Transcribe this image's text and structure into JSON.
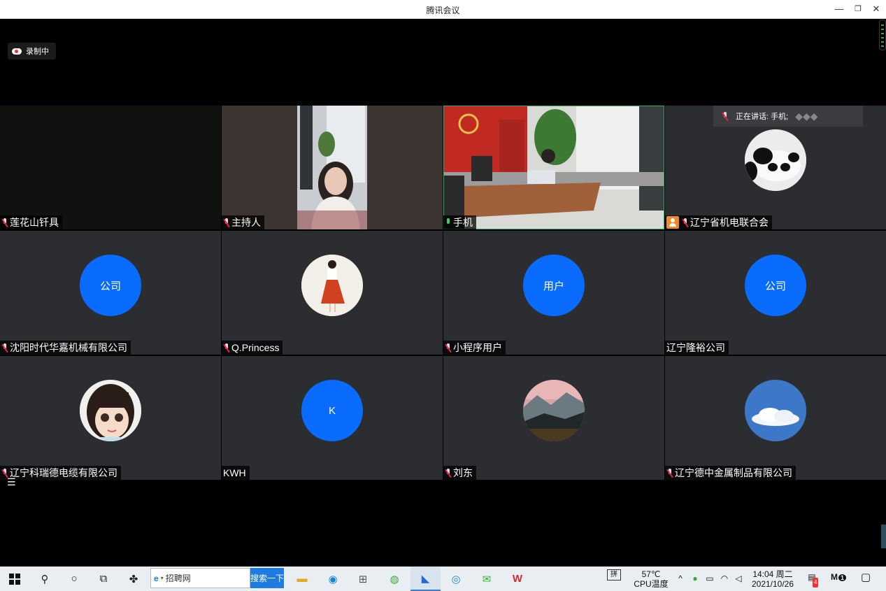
{
  "window": {
    "title": "腾讯会议",
    "minimize": "—",
    "restore": "❐",
    "close": "✕"
  },
  "recording": {
    "label": "录制中"
  },
  "speaking": {
    "label": "正在讲话: 手机;"
  },
  "tiles": [
    {
      "name": "莲花山钎具",
      "kind": "dark",
      "mic": "muted"
    },
    {
      "name": "主持人",
      "kind": "video-host",
      "mic": "muted"
    },
    {
      "name": "手机",
      "kind": "video-room",
      "mic": "on"
    },
    {
      "name": "辽宁省机电联合会",
      "kind": "panda",
      "mic": "muted",
      "badge": true
    },
    {
      "name": "沈阳时代华嘉机械有限公司",
      "kind": "avatar",
      "avatar_text": "公司",
      "mic": "muted"
    },
    {
      "name": "Q.Princess",
      "kind": "photo-girl",
      "mic": "muted"
    },
    {
      "name": "小程序用户",
      "kind": "avatar",
      "avatar_text": "用户",
      "mic": "muted"
    },
    {
      "name": "辽宁隆裕公司",
      "kind": "avatar",
      "avatar_text": "公司",
      "mic": "none"
    },
    {
      "name": "辽宁科瑞德电缆有限公司",
      "kind": "cartoon",
      "mic": "muted"
    },
    {
      "name": "KWH",
      "kind": "avatar",
      "avatar_text": "K",
      "mic": "none"
    },
    {
      "name": "刘东",
      "kind": "landscape",
      "mic": "muted"
    },
    {
      "name": "辽宁德中金属制品有限公司",
      "kind": "sky",
      "mic": "muted"
    }
  ],
  "taskbar": {
    "search_text": "招聘网",
    "search_button": "搜索一下",
    "ime": "拼",
    "cpu_temp": "57℃",
    "cpu_label": "CPU温度",
    "time": "14:04 周二",
    "date": "2021/10/26",
    "notification_count": "4",
    "app_badge": "1"
  },
  "colors": {
    "avatar_blue": "#0a6cff",
    "speaking_green": "#22b35e",
    "taskbar_bg": "#e9eef2"
  }
}
